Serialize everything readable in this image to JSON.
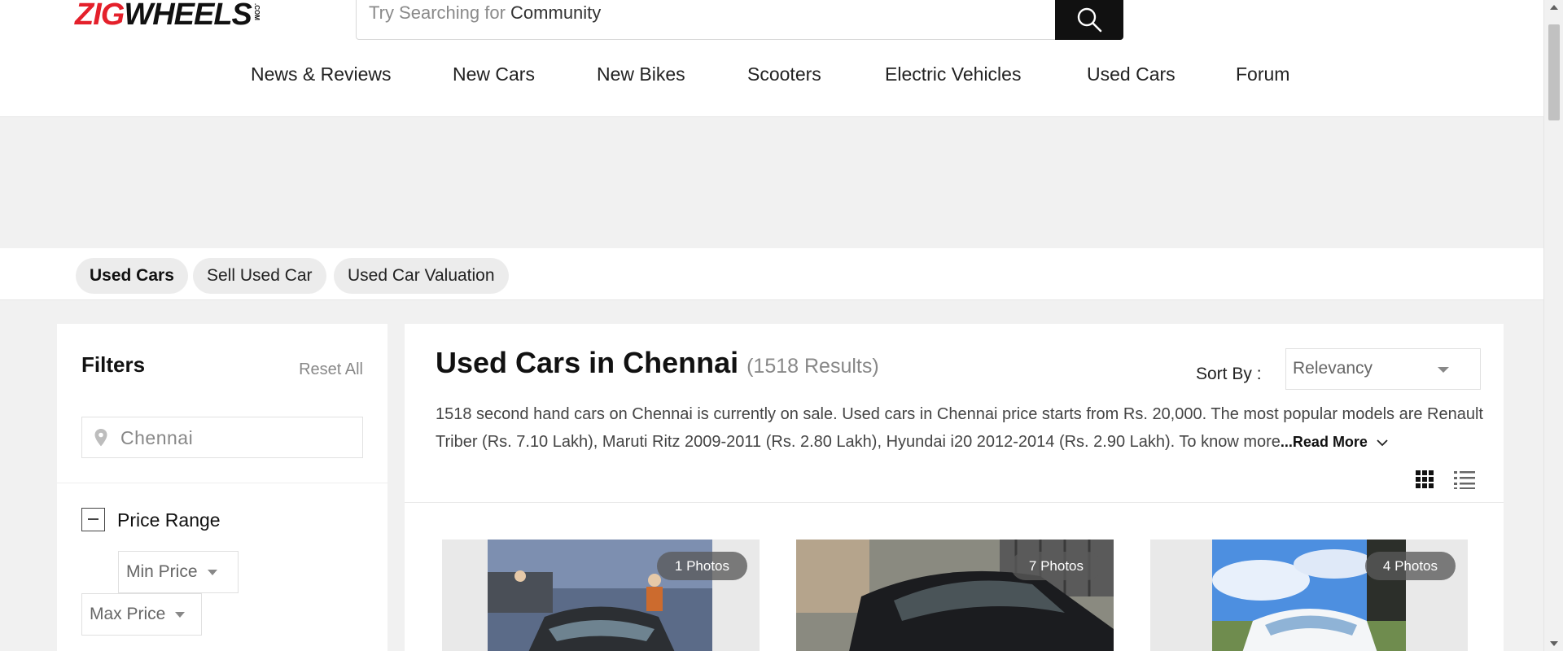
{
  "header": {
    "logo": {
      "part1": "ZIG",
      "part2": "WHEELS",
      "suffix": ".COM"
    },
    "search": {
      "placeholder": "Try Searching for",
      "term": "Community",
      "icon": "search-icon"
    },
    "nav": [
      "News & Reviews",
      "New Cars",
      "New Bikes",
      "Scooters",
      "Electric Vehicles",
      "Used Cars",
      "Forum"
    ]
  },
  "subtabs": [
    "Used Cars",
    "Sell Used Car",
    "Used Car Valuation"
  ],
  "filters": {
    "title": "Filters",
    "reset": "Reset All",
    "city": "Chennai",
    "price_range": {
      "label": "Price Range",
      "min": "Min Price",
      "max": "Max Price"
    }
  },
  "main": {
    "heading": "Used Cars in Chennai",
    "count": "(1518 Results)",
    "sort_label": "Sort By :",
    "sort_value": "Relevancy",
    "description": "1518 second hand cars on Chennai is currently on sale. Used cars in Chennai price starts from Rs. 20,000. The most popular models are Renault Triber (Rs. 7.10 Lakh), Maruti Ritz 2009-2011 (Rs. 2.80 Lakh), Hyundai i20 2012-2014 (Rs. 2.90 Lakh). To know more",
    "read_more": "...Read More",
    "cards": [
      {
        "photos": "1 Photos"
      },
      {
        "photos": "7 Photos"
      },
      {
        "photos": "4 Photos"
      }
    ]
  },
  "colors": {
    "brand_red": "#e4202b",
    "dark": "#111111",
    "bg": "#f1f1f1"
  }
}
